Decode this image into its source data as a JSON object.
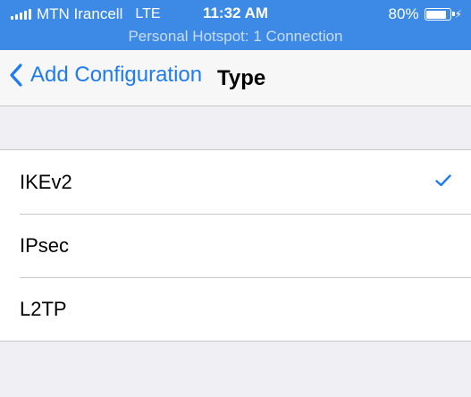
{
  "status_bar": {
    "carrier": "MTN Irancell",
    "network": "LTE",
    "time": "11:32 AM",
    "battery_percent": "80%",
    "battery_level": 0.8,
    "signal_icon": "signal-bars-icon",
    "battery_icon": "battery-icon",
    "charging_icon": "charging-bolt-icon"
  },
  "hotspot_banner": {
    "text": "Personal Hotspot: 1 Connection"
  },
  "nav": {
    "back_label": "Add Configuration",
    "title": "Type",
    "back_icon": "chevron-left-icon"
  },
  "types": [
    {
      "label": "IKEv2",
      "selected": true
    },
    {
      "label": "IPsec",
      "selected": false
    },
    {
      "label": "L2TP",
      "selected": false
    }
  ],
  "colors": {
    "accent": "#1f7bf0",
    "status_bar": "#3d8ae6",
    "background": "#efeff4"
  }
}
